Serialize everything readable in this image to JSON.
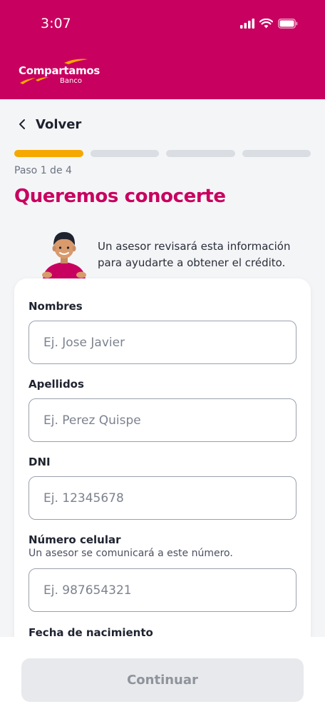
{
  "status_bar": {
    "time": "3:07"
  },
  "brand": {
    "name": "Compartamos",
    "subtitle": "Banco"
  },
  "nav": {
    "back_label": "Volver"
  },
  "progress": {
    "current_step": 1,
    "total_steps": 4,
    "step_text": "Paso 1 de 4"
  },
  "page_title": "Queremos conocerte",
  "advisor_message": "Un asesor revisará esta información para ayudarte a obtener el crédito.",
  "form": {
    "fields": [
      {
        "label": "Nombres",
        "placeholder": "Ej. Jose Javier",
        "value": ""
      },
      {
        "label": "Apellidos",
        "placeholder": "Ej. Perez Quispe",
        "value": ""
      },
      {
        "label": "DNI",
        "placeholder": "Ej. 12345678",
        "value": ""
      },
      {
        "label": "Número celular",
        "help": "Un asesor se comunicará a este número.",
        "placeholder": "Ej. 987654321",
        "value": ""
      },
      {
        "label": "Fecha de nacimiento"
      }
    ]
  },
  "footer": {
    "continue_label": "Continuar",
    "continue_enabled": false
  },
  "colors": {
    "brand": "#c8005f",
    "progress_active": "#f5a800",
    "progress_inactive": "#dadde2"
  },
  "icons": [
    "signal-icon",
    "wifi-icon",
    "battery-icon",
    "chevron-left-icon"
  ]
}
